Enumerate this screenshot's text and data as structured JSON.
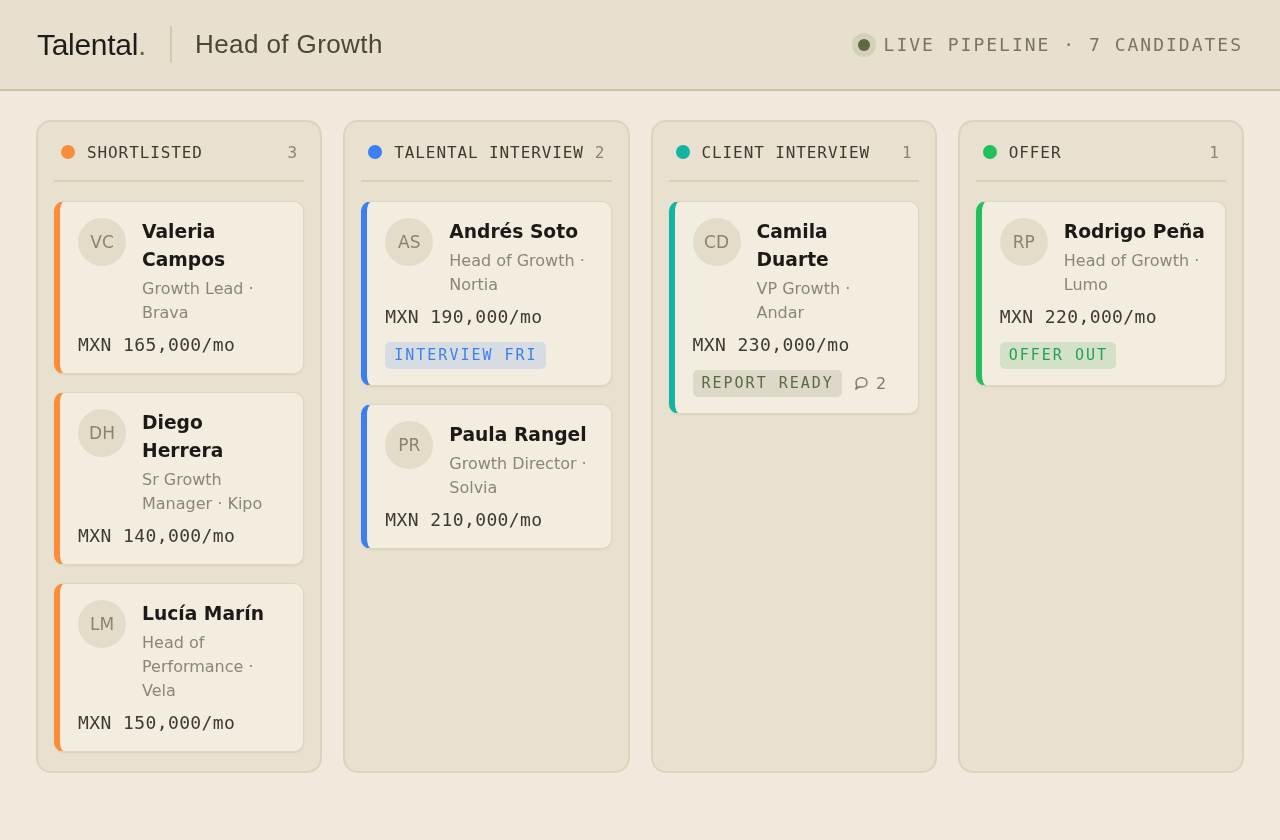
{
  "header": {
    "logo": {
      "text": "Talental",
      "dot": "."
    },
    "title": "Head of Growth",
    "status": "LIVE PIPELINE · 7 CANDIDATES"
  },
  "columns": [
    {
      "title": "SHORTLISTED",
      "count": "3",
      "color": "#fb8c3a",
      "cards": [
        {
          "initials": "VC",
          "name": "Valeria Campos",
          "role": "Growth Lead · Brava",
          "salary": "MXN 165,000/mo"
        },
        {
          "initials": "DH",
          "name": "Diego Herrera",
          "role": "Sr Growth Manager · Kipo",
          "salary": "MXN 140,000/mo"
        },
        {
          "initials": "LM",
          "name": "Lucía Marín",
          "role": "Head of Performance · Vela",
          "salary": "MXN 150,000/mo"
        }
      ]
    },
    {
      "title": "TALENTAL INTERVIEW",
      "count": "2",
      "color": "#3b7ff0",
      "cards": [
        {
          "initials": "AS",
          "name": "Andrés Soto",
          "role": "Head of Growth · Nortia",
          "salary": "MXN 190,000/mo",
          "tag": {
            "label": "INTERVIEW FRI",
            "color": "#3b7ff0"
          }
        },
        {
          "initials": "PR",
          "name": "Paula Rangel",
          "role": "Growth Director · Solvia",
          "salary": "MXN 210,000/mo"
        }
      ]
    },
    {
      "title": "CLIENT INTERVIEW",
      "count": "1",
      "color": "#14b4a2",
      "cards": [
        {
          "initials": "CD",
          "name": "Camila Duarte",
          "role": "VP Growth · Andar",
          "salary": "MXN 230,000/mo",
          "tag": {
            "label": "REPORT READY",
            "color": "#5c6a42"
          },
          "comments": "2"
        }
      ]
    },
    {
      "title": "OFFER",
      "count": "1",
      "color": "#22c05a",
      "cards": [
        {
          "initials": "RP",
          "name": "Rodrigo Peña",
          "role": "Head of Growth · Lumo",
          "salary": "MXN 220,000/mo",
          "tag": {
            "label": "OFFER OUT",
            "color": "#23a24c"
          }
        }
      ]
    }
  ]
}
